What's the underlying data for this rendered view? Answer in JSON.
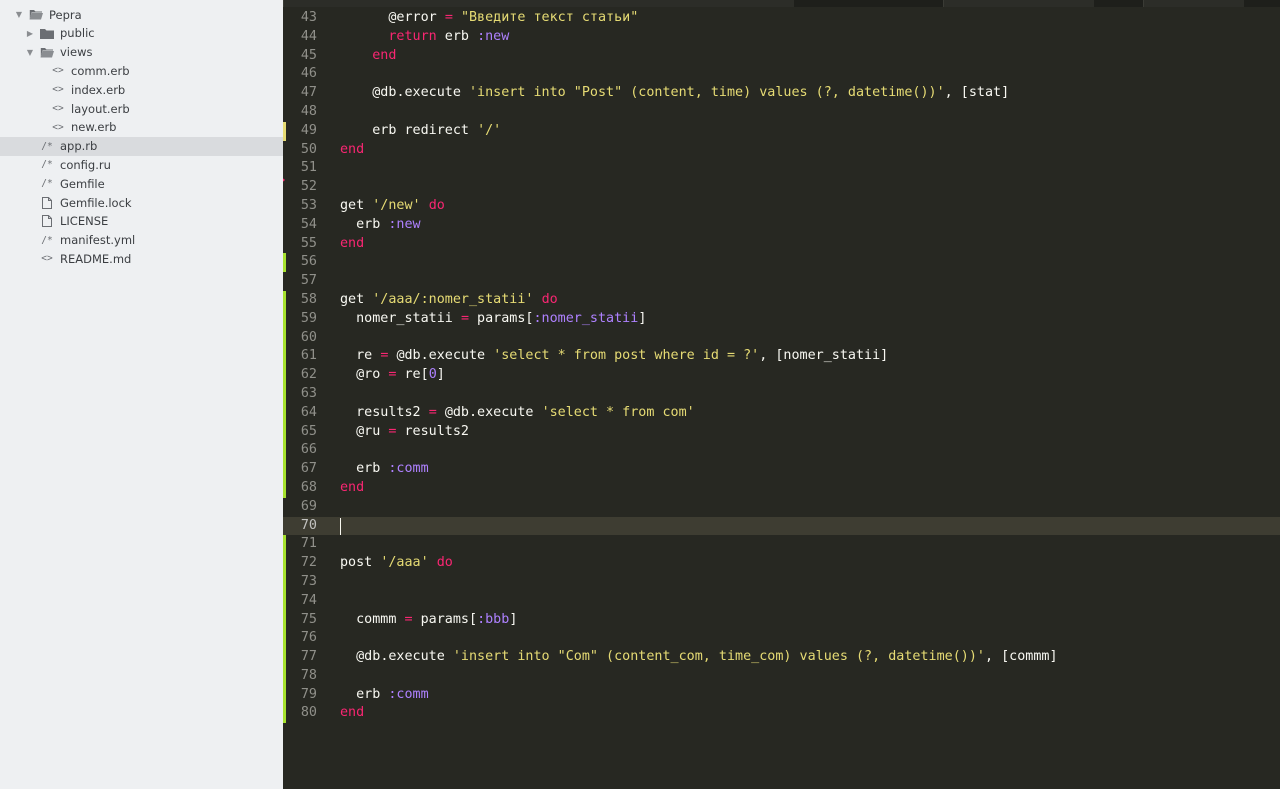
{
  "sidebar": {
    "items": [
      {
        "label": "Pepra",
        "kind": "folder-open",
        "depth": 0,
        "disclosure": "open"
      },
      {
        "label": "public",
        "kind": "folder",
        "depth": 1,
        "disclosure": "closed"
      },
      {
        "label": "views",
        "kind": "folder-open",
        "depth": 1,
        "disclosure": "open"
      },
      {
        "label": "comm.erb",
        "kind": "markup",
        "depth": 2
      },
      {
        "label": "index.erb",
        "kind": "markup",
        "depth": 2
      },
      {
        "label": "layout.erb",
        "kind": "markup",
        "depth": 2
      },
      {
        "label": "new.erb",
        "kind": "markup",
        "depth": 2
      },
      {
        "label": "app.rb",
        "kind": "code",
        "depth": 1,
        "selected": true
      },
      {
        "label": "config.ru",
        "kind": "code",
        "depth": 1
      },
      {
        "label": "Gemfile",
        "kind": "code",
        "depth": 1
      },
      {
        "label": "Gemfile.lock",
        "kind": "file",
        "depth": 1
      },
      {
        "label": "LICENSE",
        "kind": "file",
        "depth": 1
      },
      {
        "label": "manifest.yml",
        "kind": "code",
        "depth": 1
      },
      {
        "label": "README.md",
        "kind": "markup",
        "depth": 1
      }
    ]
  },
  "editor": {
    "colors": {
      "background": "#272822",
      "keyword": "#f92672",
      "string": "#e6db74",
      "symbol": "#ae81ff",
      "added": "#a6e22e",
      "modified": "#e6db74"
    },
    "current_line": 70,
    "lines": [
      {
        "n": "43",
        "mark": "",
        "tokens": [
          [
            "txt",
            "      "
          ],
          [
            "ivar",
            "@error"
          ],
          [
            "txt",
            " "
          ],
          [
            "op",
            "="
          ],
          [
            "txt",
            " "
          ],
          [
            "str",
            "\"Введите текст статьи\""
          ]
        ]
      },
      {
        "n": "44",
        "mark": "",
        "tokens": [
          [
            "txt",
            "      "
          ],
          [
            "kw",
            "return"
          ],
          [
            "txt",
            " erb "
          ],
          [
            "sym",
            ":new"
          ]
        ]
      },
      {
        "n": "45",
        "mark": "",
        "tokens": [
          [
            "txt",
            "    "
          ],
          [
            "kw",
            "end"
          ]
        ]
      },
      {
        "n": "46",
        "mark": "",
        "tokens": []
      },
      {
        "n": "47",
        "mark": "",
        "tokens": [
          [
            "txt",
            "    "
          ],
          [
            "ivar",
            "@db"
          ],
          [
            "txt",
            ".execute "
          ],
          [
            "str",
            "'insert into \"Post\" (content, time) values (?, datetime())'"
          ],
          [
            "txt",
            ", [stat]"
          ]
        ]
      },
      {
        "n": "48",
        "mark": "",
        "tokens": []
      },
      {
        "n": "49",
        "mark": "modified",
        "tokens": [
          [
            "txt",
            "    erb redirect "
          ],
          [
            "str",
            "'/'"
          ]
        ]
      },
      {
        "n": "50",
        "mark": "",
        "tokens": [
          [
            "kw",
            "end"
          ]
        ]
      },
      {
        "n": "51",
        "mark": "",
        "tokens": []
      },
      {
        "n": "52",
        "mark": "error",
        "tokens": []
      },
      {
        "n": "53",
        "mark": "",
        "tokens": [
          [
            "txt",
            "get "
          ],
          [
            "str",
            "'/new'"
          ],
          [
            "txt",
            " "
          ],
          [
            "kw",
            "do"
          ]
        ]
      },
      {
        "n": "54",
        "mark": "",
        "tokens": [
          [
            "txt",
            "  erb "
          ],
          [
            "sym",
            ":new"
          ]
        ]
      },
      {
        "n": "55",
        "mark": "",
        "tokens": [
          [
            "kw",
            "end"
          ]
        ]
      },
      {
        "n": "56",
        "mark": "added",
        "tokens": []
      },
      {
        "n": "57",
        "mark": "",
        "tokens": []
      },
      {
        "n": "58",
        "mark": "added",
        "tokens": [
          [
            "txt",
            "get "
          ],
          [
            "str",
            "'/aaa/:nomer_statii'"
          ],
          [
            "txt",
            " "
          ],
          [
            "kw",
            "do"
          ]
        ]
      },
      {
        "n": "59",
        "mark": "added",
        "tokens": [
          [
            "txt",
            "  nomer_statii "
          ],
          [
            "op",
            "="
          ],
          [
            "txt",
            " params["
          ],
          [
            "sym",
            ":nomer_statii"
          ],
          [
            "txt",
            "]"
          ]
        ]
      },
      {
        "n": "60",
        "mark": "added",
        "tokens": []
      },
      {
        "n": "61",
        "mark": "added",
        "tokens": [
          [
            "txt",
            "  re "
          ],
          [
            "op",
            "="
          ],
          [
            "txt",
            " "
          ],
          [
            "ivar",
            "@db"
          ],
          [
            "txt",
            ".execute "
          ],
          [
            "str",
            "'select * from post where id = ?'"
          ],
          [
            "txt",
            ", [nomer_statii]"
          ]
        ]
      },
      {
        "n": "62",
        "mark": "added",
        "tokens": [
          [
            "txt",
            "  "
          ],
          [
            "ivar",
            "@ro"
          ],
          [
            "txt",
            " "
          ],
          [
            "op",
            "="
          ],
          [
            "txt",
            " re["
          ],
          [
            "num",
            "0"
          ],
          [
            "txt",
            "]"
          ]
        ]
      },
      {
        "n": "63",
        "mark": "added",
        "tokens": []
      },
      {
        "n": "64",
        "mark": "added",
        "tokens": [
          [
            "txt",
            "  results2 "
          ],
          [
            "op",
            "="
          ],
          [
            "txt",
            " "
          ],
          [
            "ivar",
            "@db"
          ],
          [
            "txt",
            ".execute "
          ],
          [
            "str",
            "'select * from com'"
          ]
        ]
      },
      {
        "n": "65",
        "mark": "added",
        "tokens": [
          [
            "txt",
            "  "
          ],
          [
            "ivar",
            "@ru"
          ],
          [
            "txt",
            " "
          ],
          [
            "op",
            "="
          ],
          [
            "txt",
            " results2"
          ]
        ]
      },
      {
        "n": "66",
        "mark": "added",
        "tokens": []
      },
      {
        "n": "67",
        "mark": "added",
        "tokens": [
          [
            "txt",
            "  erb "
          ],
          [
            "sym",
            ":comm"
          ]
        ]
      },
      {
        "n": "68",
        "mark": "added",
        "tokens": [
          [
            "kw",
            "end"
          ]
        ]
      },
      {
        "n": "69",
        "mark": "",
        "tokens": []
      },
      {
        "n": "70",
        "mark": "",
        "tokens": []
      },
      {
        "n": "71",
        "mark": "added",
        "tokens": []
      },
      {
        "n": "72",
        "mark": "added",
        "tokens": [
          [
            "txt",
            "post "
          ],
          [
            "str",
            "'/aaa'"
          ],
          [
            "txt",
            " "
          ],
          [
            "kw",
            "do"
          ]
        ]
      },
      {
        "n": "73",
        "mark": "added",
        "tokens": []
      },
      {
        "n": "74",
        "mark": "added",
        "tokens": []
      },
      {
        "n": "75",
        "mark": "added",
        "tokens": [
          [
            "txt",
            "  commm "
          ],
          [
            "op",
            "="
          ],
          [
            "txt",
            " params["
          ],
          [
            "sym",
            ":bbb"
          ],
          [
            "txt",
            "]"
          ]
        ]
      },
      {
        "n": "76",
        "mark": "added",
        "tokens": []
      },
      {
        "n": "77",
        "mark": "added",
        "tokens": [
          [
            "txt",
            "  "
          ],
          [
            "ivar",
            "@db"
          ],
          [
            "txt",
            ".execute "
          ],
          [
            "str",
            "'insert into \"Com\" (content_com, time_com) values (?, datetime())'"
          ],
          [
            "txt",
            ", [commm]"
          ]
        ]
      },
      {
        "n": "78",
        "mark": "added",
        "tokens": []
      },
      {
        "n": "79",
        "mark": "added",
        "tokens": [
          [
            "txt",
            "  erb "
          ],
          [
            "sym",
            ":comm"
          ]
        ]
      },
      {
        "n": "80",
        "mark": "added",
        "tokens": [
          [
            "kw",
            "end"
          ]
        ]
      }
    ]
  }
}
